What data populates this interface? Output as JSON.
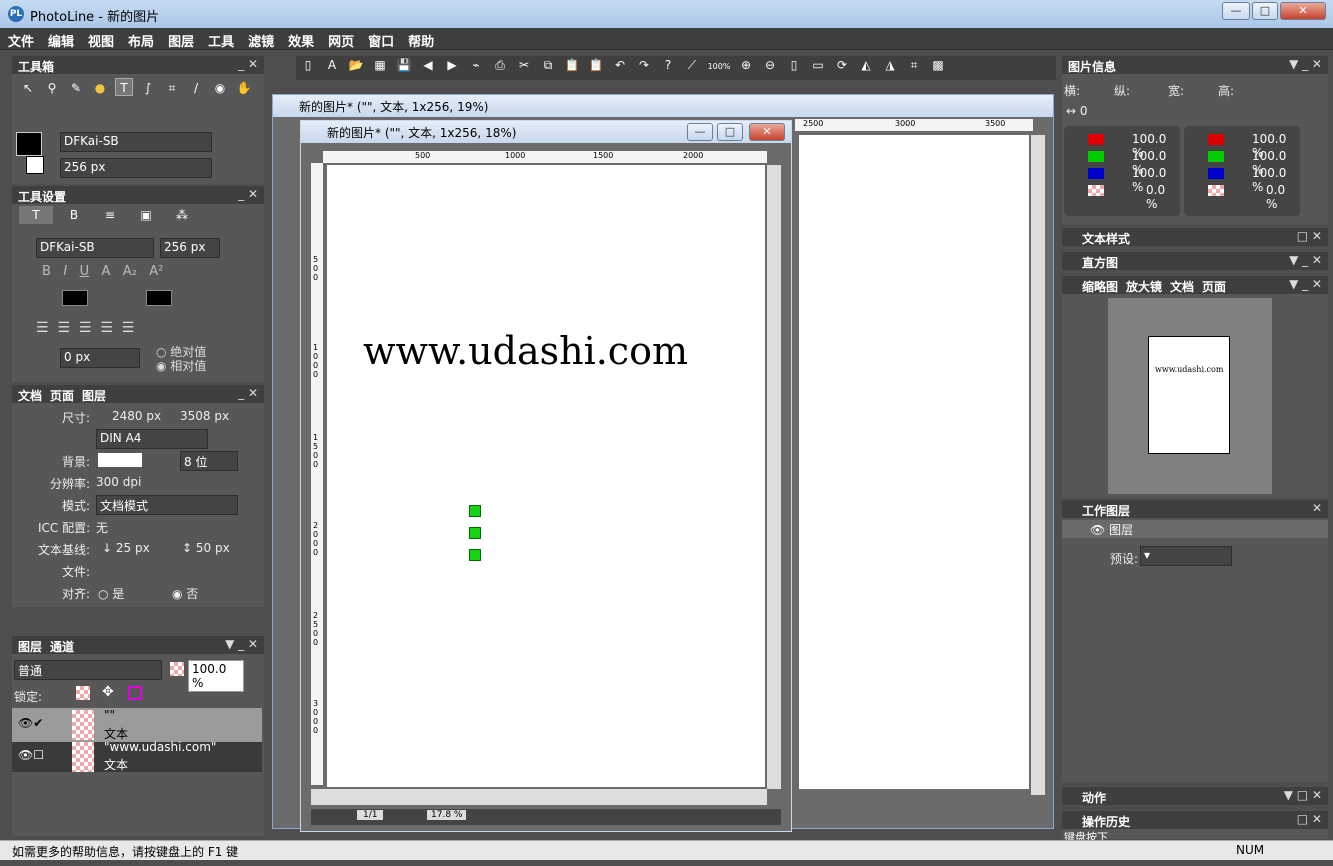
{
  "window": {
    "title": "PhotoLine - 新的图片",
    "app_icon": "PL",
    "minimize": "—",
    "maximize": "□",
    "close": "✕"
  },
  "menu": [
    "文件",
    "编辑",
    "视图",
    "布局",
    "图层",
    "工具",
    "滤镜",
    "效果",
    "网页",
    "窗口",
    "帮助"
  ],
  "toolbox": {
    "title": "工具箱",
    "font": "DFKai-SB",
    "size": "256 px"
  },
  "tool_settings": {
    "title": "工具设置",
    "tabs": [
      "T",
      "B",
      "≡",
      "▣",
      "⁂"
    ],
    "font": "DFKai-SB",
    "size": "256 px",
    "offset": "0 px",
    "radio_abs": "绝对值",
    "radio_rel": "相对值"
  },
  "doc_panel": {
    "tabs": [
      "文档",
      "页面",
      "图层"
    ],
    "size_label": "尺寸:",
    "width": "2480 px",
    "height": "3508 px",
    "paper": "DIN A4",
    "bg_label": "背景:",
    "bits": "8 位",
    "res_label": "分辨率:",
    "res": "300 dpi",
    "mode_label": "模式:",
    "mode": "文档模式",
    "icc_label": "ICC 配置:",
    "icc": "无",
    "baseline_label": "文本基线:",
    "base1": "25 px",
    "base2": "50 px",
    "file_label": "文件:",
    "align_label": "对齐:",
    "yes": "是",
    "no": "否"
  },
  "layers_panel": {
    "tabs": [
      "图层",
      "通道"
    ],
    "blend": "普通",
    "opacity": "100.0 %",
    "lock_label": "锁定:",
    "layers": [
      {
        "name": "\"\"",
        "type": "文本"
      },
      {
        "name": "\"www.udashi.com\"",
        "type": "文本"
      }
    ]
  },
  "toolbar": {
    "zoom_label": "100%"
  },
  "doc_back": {
    "title": "新的图片* (\"\", 文本, 1x256, 19%)",
    "ruler": [
      "2500",
      "3000",
      "3500"
    ]
  },
  "doc_front": {
    "title": "新的图片* (\"\", 文本, 1x256, 18%)",
    "ruler": [
      "500",
      "1000",
      "1500",
      "2000"
    ],
    "vruler": [
      "5 0 0",
      "1 0 0 0",
      "1 5 0 0",
      "2 0 0 0",
      "2 5 0 0",
      "3 0 0 0"
    ],
    "canvas_text": "www.udashi.com",
    "page": "1/1",
    "zoom": "17.8 %"
  },
  "image_info": {
    "title": "图片信息",
    "h": "横:",
    "v": "纵:",
    "w": "宽:",
    "ht": "高:",
    "dist": "0",
    "rgb_left": [
      "100.0 %",
      "100.0 %",
      "100.0 %",
      "0.0 %"
    ],
    "rgb_right": [
      "100.0 %",
      "100.0 %",
      "100.0 %",
      "0.0 %"
    ]
  },
  "right_panels": {
    "text_style": "文本样式",
    "histogram": "直方图",
    "nav_tabs": [
      "缩略图",
      "放大镜",
      "文档",
      "页面"
    ],
    "thumb_text": "www.udashi.com",
    "work_layers": "工作图层",
    "layer_group": "图层",
    "preset_label": "预设:",
    "actions": "动作",
    "history": "操作历史",
    "history_item": "键盘按下"
  },
  "status": {
    "text": "如需更多的帮助信息，请按键盘上的 F1 键",
    "num": "NUM"
  }
}
